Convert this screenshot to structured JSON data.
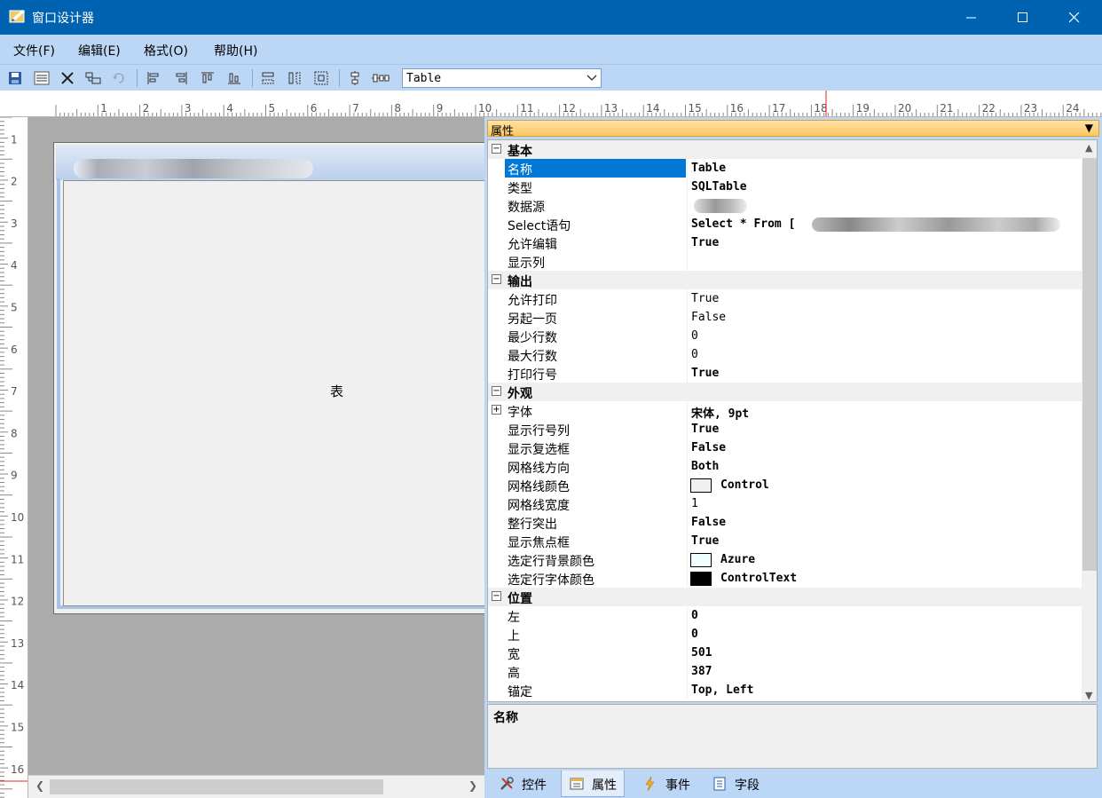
{
  "window": {
    "title": "窗口设计器"
  },
  "menu": [
    "文件(F)",
    "编辑(E)",
    "格式(O)",
    "帮助(H)"
  ],
  "toolbar": {
    "icons": [
      "save-icon",
      "properties-icon",
      "delete-icon",
      "copy-icon",
      "undo-icon",
      "align-left-icon",
      "align-right-icon",
      "align-top-icon",
      "align-bottom-icon",
      "same-width-icon",
      "same-height-icon",
      "same-size-icon",
      "center-vertical-icon",
      "center-horizontal-icon"
    ],
    "control_select": "Table"
  },
  "ruler": {
    "h_labels": [
      "1",
      "2",
      "3",
      "4",
      "5",
      "6",
      "7",
      "8",
      "9",
      "10",
      "11",
      "12",
      "13",
      "14",
      "15",
      "16",
      "17",
      "18",
      "19",
      "20",
      "21",
      "22",
      "23",
      "24"
    ],
    "v_labels": [
      "1",
      "2",
      "3",
      "4",
      "5",
      "6",
      "7",
      "8",
      "9",
      "10",
      "11",
      "12",
      "13",
      "14",
      "15",
      "16"
    ]
  },
  "canvas": {
    "table_label": "表"
  },
  "properties": {
    "header": "属性",
    "pin": "ᵖ",
    "categories": [
      {
        "name": "基本",
        "items": [
          {
            "name": "名称",
            "value": "Table",
            "bold": true,
            "selected": true
          },
          {
            "name": "类型",
            "value": "SQLTable",
            "bold": true
          },
          {
            "name": "数据源",
            "value": "",
            "blurred": true
          },
          {
            "name": "Select语句",
            "value": "Select * From [",
            "bold": true,
            "blurred_tail": true
          },
          {
            "name": "允许编辑",
            "value": "True",
            "bold": true
          },
          {
            "name": "显示列",
            "value": ""
          }
        ]
      },
      {
        "name": "输出",
        "items": [
          {
            "name": "允许打印",
            "value": "True"
          },
          {
            "name": "另起一页",
            "value": "False"
          },
          {
            "name": "最少行数",
            "value": "0"
          },
          {
            "name": "最大行数",
            "value": "0"
          },
          {
            "name": "打印行号",
            "value": "True",
            "bold": true
          }
        ]
      },
      {
        "name": "外观",
        "items": [
          {
            "name": "字体",
            "value": "宋体, 9pt",
            "bold": true,
            "expandable": true
          },
          {
            "name": "显示行号列",
            "value": "True",
            "bold": true
          },
          {
            "name": "显示复选框",
            "value": "False",
            "bold": true
          },
          {
            "name": "网格线方向",
            "value": "Both",
            "bold": true
          },
          {
            "name": "网格线颜色",
            "value": "Control",
            "swatch": "#f0f0f0"
          },
          {
            "name": "网格线宽度",
            "value": "1"
          },
          {
            "name": "整行突出",
            "value": "False",
            "bold": true
          },
          {
            "name": "显示焦点框",
            "value": "True",
            "bold": true
          },
          {
            "name": "选定行背景颜色",
            "value": "Azure",
            "swatch": "#f0ffff"
          },
          {
            "name": "选定行字体颜色",
            "value": "ControlText",
            "swatch": "#000000"
          }
        ]
      },
      {
        "name": "位置",
        "items": [
          {
            "name": "左",
            "value": "0",
            "bold": true
          },
          {
            "name": "上",
            "value": "0",
            "bold": true
          },
          {
            "name": "宽",
            "value": "501",
            "bold": true
          },
          {
            "name": "高",
            "value": "387",
            "bold": true
          },
          {
            "name": "锚定",
            "value": "Top, Left",
            "bold": true
          }
        ]
      }
    ],
    "description_title": "名称"
  },
  "tabs": [
    {
      "label": "控件",
      "icon": "tools-icon"
    },
    {
      "label": "属性",
      "icon": "properties-icon",
      "active": true
    },
    {
      "label": "事件",
      "icon": "lightning-icon"
    },
    {
      "label": "字段",
      "icon": "list-icon"
    }
  ],
  "colors": {
    "titlebar": "#0063b1",
    "menubar": "#bcd6f5",
    "selection": "#0078d7",
    "panel_header": "#ffc662"
  }
}
